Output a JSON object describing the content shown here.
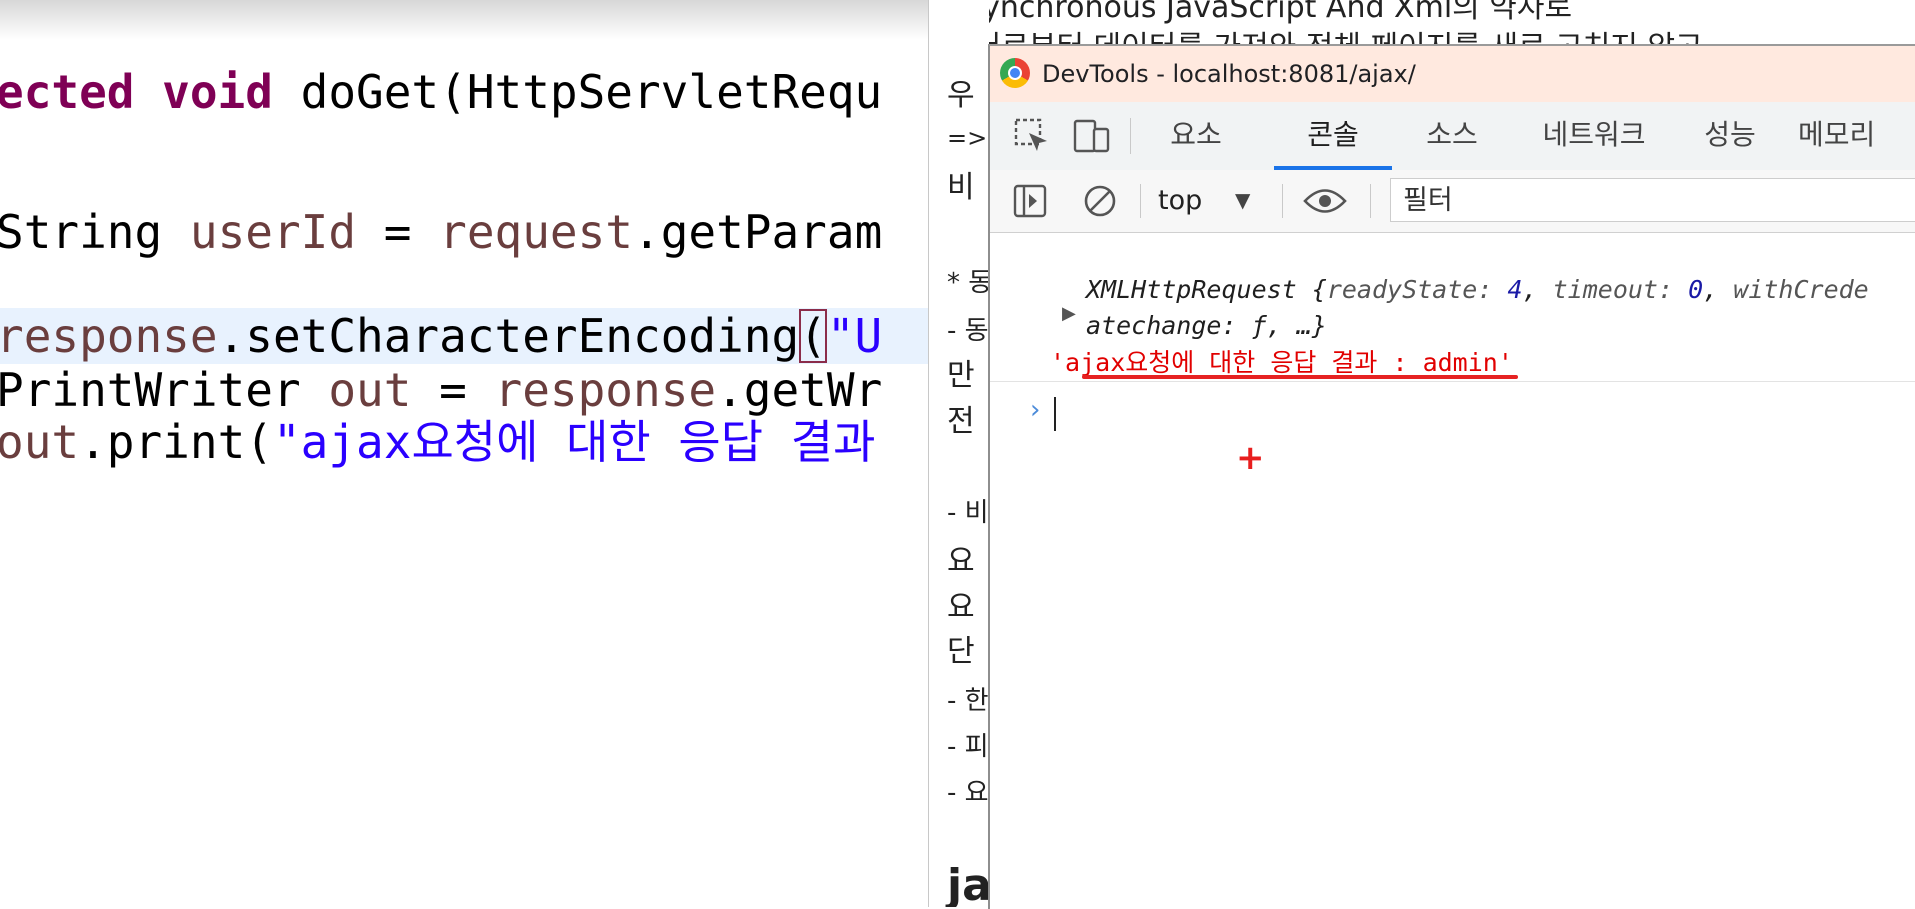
{
  "editor": {
    "lines": [
      {
        "id": "line1",
        "parts": [
          [
            "kw",
            "ected "
          ],
          [
            "kw",
            "void "
          ],
          [
            "typ",
            "doGet(HttpServletRequ"
          ]
        ]
      },
      {
        "id": "line2",
        "parts": [
          [
            "typ",
            "String "
          ],
          [
            "var",
            "userId"
          ],
          [
            "typ",
            " = "
          ],
          [
            "var",
            "request"
          ],
          [
            "typ",
            ".getParam"
          ]
        ]
      },
      {
        "id": "line3",
        "parts": [
          [
            "var",
            "response"
          ],
          [
            "typ",
            ".setCharacterEncoding"
          ],
          [
            "box",
            "("
          ],
          [
            "str",
            "\"U"
          ]
        ]
      },
      {
        "id": "line4",
        "parts": [
          [
            "typ",
            "PrintWriter "
          ],
          [
            "var",
            "out"
          ],
          [
            "typ",
            " = "
          ],
          [
            "var",
            "response"
          ],
          [
            "typ",
            ".getWr"
          ]
        ]
      },
      {
        "id": "line5",
        "parts": [
          [
            "var",
            "out"
          ],
          [
            "typ",
            ".print("
          ],
          [
            "str",
            "\"ajax요청에 대한 응답 결과"
          ]
        ]
      }
    ]
  },
  "background_doc": {
    "heading": "Asynchronous JavaScript And Xml의 약자로",
    "line2": "서버로부터 데이터를 가져와 전체 페이지를 새로 고치지 않고",
    "fragments": [
      "우",
      "=>",
      "비",
      "* 동",
      "- 동",
      "만",
      "전",
      "- 비",
      "요",
      "요",
      "단",
      "- 한",
      "- 피",
      "- 요",
      "ja"
    ]
  },
  "devtools": {
    "window_title": "DevTools - localhost:8081/ajax/",
    "tabs": [
      "요소",
      "콘솔",
      "소스",
      "네트워크",
      "성능",
      "메모리"
    ],
    "active_tab": "콘솔",
    "context": "top",
    "filter_placeholder": "필터",
    "console": {
      "xhr_object": "XMLHttpRequest",
      "xhr_props": [
        {
          "key": "readyState",
          "value": "4"
        },
        {
          "key": "timeout",
          "value": "0"
        },
        {
          "key": "withCrede",
          "value": ""
        }
      ],
      "xhr_continuation": "atechange: ƒ, …}",
      "log_message": "'ajax요청에 대한 응답 결과 : admin'"
    }
  },
  "colors": {
    "keyword": "#7f0055",
    "string": "#2a00ff",
    "variable": "#6a3e3e",
    "titlebar": "#ffe9df",
    "active_tab_underline": "#1a73e8",
    "log_text": "#e10000",
    "annotation_underline": "#e62222"
  },
  "icons": [
    "inspect-element-icon",
    "device-toolbar-icon",
    "sidebar-toggle-icon",
    "clear-console-icon",
    "live-expression-eye-icon",
    "chrome-logo-icon",
    "expand-triangle-icon",
    "console-prompt-icon",
    "crosshair-cursor-icon"
  ]
}
